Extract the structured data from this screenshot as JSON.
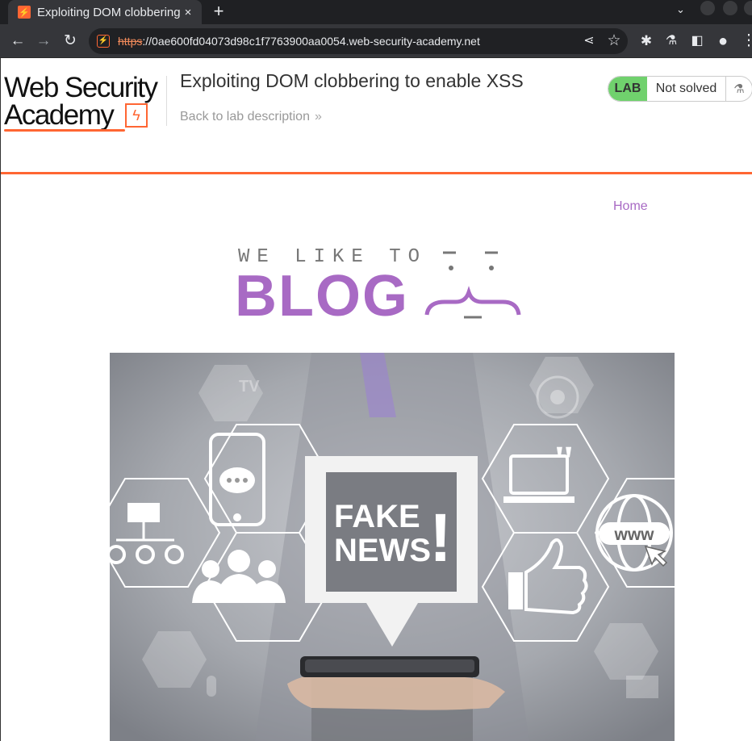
{
  "browser": {
    "tab_title": "Exploiting DOM clobbering to enable XSS",
    "tab_close": "×",
    "new_tab": "+",
    "url_scheme": "https",
    "url_rest": "://0ae600fd04073d98c1f7763900aa0054.web-security-academy.net"
  },
  "header": {
    "logo_line1": "Web Security",
    "logo_line2": "Academy",
    "lab_title": "Exploiting DOM clobbering to enable XSS",
    "back_link": "Back to lab description",
    "lab_badge": "LAB",
    "lab_status": "Not solved"
  },
  "nav": {
    "home": "Home"
  },
  "blog": {
    "tagline": "WE LIKE TO",
    "brand": "BLOG"
  },
  "hero": {
    "headline_line1": "FAKE",
    "headline_line2": "NEWS",
    "exclaim": "!",
    "www": "www",
    "tv": "TV"
  },
  "colors": {
    "accent_orange": "#ff6633",
    "blog_purple": "#a86ac4",
    "lab_green": "#70d16d"
  }
}
